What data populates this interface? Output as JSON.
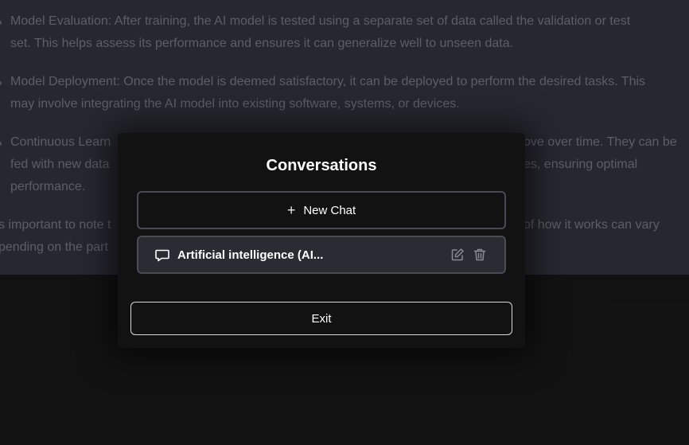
{
  "background": {
    "paragraphs": [
      {
        "lines": [
          "Model Evaluation: After training, the AI model is tested using a separate set of data called the validation or test",
          "set. This helps assess its performance and ensures it can generalize well to unseen data."
        ]
      },
      {
        "lines": [
          "Model Deployment: Once the model is deemed satisfactory, it can be deployed to perform the desired tasks. This",
          "may involve integrating the AI model into existing software, systems, or devices."
        ]
      },
      {
        "lines": [
          "Continuous Learn",
          "ove over time. They can be",
          "fed with new data",
          "es, ensuring optimal",
          "performance."
        ]
      },
      {
        "lines": [
          "s important to note t",
          "of how it works can vary",
          "pending on the part"
        ]
      }
    ]
  },
  "modal": {
    "title": "Conversations",
    "new_chat_label": "New Chat",
    "new_chat_icon": "plus-icon",
    "conversations": [
      {
        "label": "Artificial intelligence (AI...",
        "icon": "chat-bubble-icon"
      }
    ],
    "exit_label": "Exit"
  },
  "colors": {
    "page_background": "#343541",
    "modal_background": "#121212",
    "conversation_item_background": "#2a2b33",
    "border": "#4a4b55"
  }
}
